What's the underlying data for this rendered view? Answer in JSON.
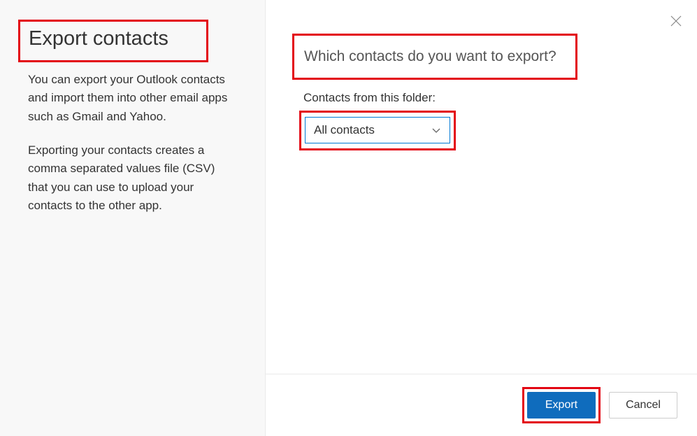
{
  "sidebar": {
    "title": "Export contacts",
    "description1": "You can export your Outlook contacts and import them into other email apps such as Gmail and Yahoo.",
    "description2": "Exporting your contacts creates a comma separated values file (CSV) that you can use to upload your contacts to the other app."
  },
  "main": {
    "question": "Which contacts do you want to export?",
    "folder_label": "Contacts from this folder:",
    "dropdown_value": "All contacts"
  },
  "footer": {
    "export_label": "Export",
    "cancel_label": "Cancel"
  }
}
